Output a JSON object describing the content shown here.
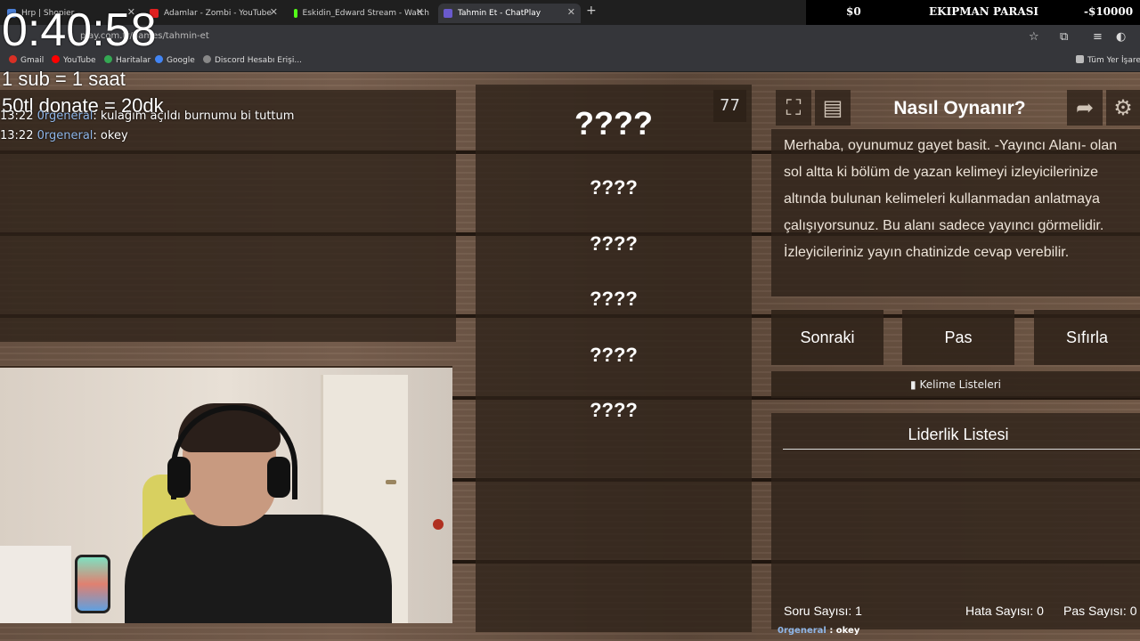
{
  "browser": {
    "tabs": [
      {
        "label": "Hrp | Shopier",
        "icon_color": "#4a7fd6"
      },
      {
        "label": "Adamlar - Zombi - YouTube",
        "icon_color": "#e02020"
      },
      {
        "label": "Eskidin_Edward Stream - Watch",
        "icon_color": "#53fc18"
      },
      {
        "label": "Tahmin Et - ChatPlay",
        "icon_color": "#6a5acd"
      }
    ],
    "new_tab": "+",
    "url": "play.com.tr/games/tahmin-et",
    "bookmarks": [
      {
        "label": "Gmail",
        "color": "#d93025"
      },
      {
        "label": "YouTube",
        "color": "#ff0000"
      },
      {
        "label": "Haritalar",
        "color": "#34a853"
      },
      {
        "label": "Google",
        "color": "#4285f4"
      },
      {
        "label": "Discord Hesabı Erişi...",
        "color": "#888888"
      },
      {
        "label": "Tüm Yer İşaretl",
        "color": "#bbbbbb"
      }
    ]
  },
  "banner": {
    "left": "$0",
    "center": "EKIPMAN PARASI",
    "right": "-$10000"
  },
  "overlay": {
    "timer": "0:40:58",
    "line1": "1 sub = 1 saat",
    "line2": "50tl donate =  20dk",
    "chat": [
      {
        "time": "13:22",
        "user": "0rgeneral",
        "message": ": kulağım açıldı burnumu bi tuttum"
      },
      {
        "time": "13:22",
        "user": "0rgeneral",
        "message": ": okey"
      }
    ]
  },
  "game": {
    "counter": "77",
    "words": [
      "????",
      "????",
      "????",
      "????",
      "????",
      "????"
    ],
    "title": "Nasıl Oynanır?",
    "instructions": "Merhaba, oyunumuz gayet basit. -Yayıncı Alanı- olan sol altta ki bölüm de yazan kelimeyi izleyicilerinize altında bulunan kelimeleri kullanmadan anlatmaya çalışıyorsunuz. Bu alanı sadece yayıncı görmelidir. İzleyicileriniz yayın chatinizde cevap verebilir.",
    "buttons": {
      "next": "Sonraki",
      "pass": "Pas",
      "reset": "Sıfırla"
    },
    "word_lists": "Kelime Listeleri",
    "leaderboard_title": "Liderlik Listesi",
    "stats": {
      "questions": "Soru Sayısı: 1",
      "errors": "Hata Sayısı: 0",
      "passes": "Pas Sayısı: 0"
    },
    "bottom_chat": {
      "user": "0rgeneral",
      "message": " : okey"
    }
  }
}
